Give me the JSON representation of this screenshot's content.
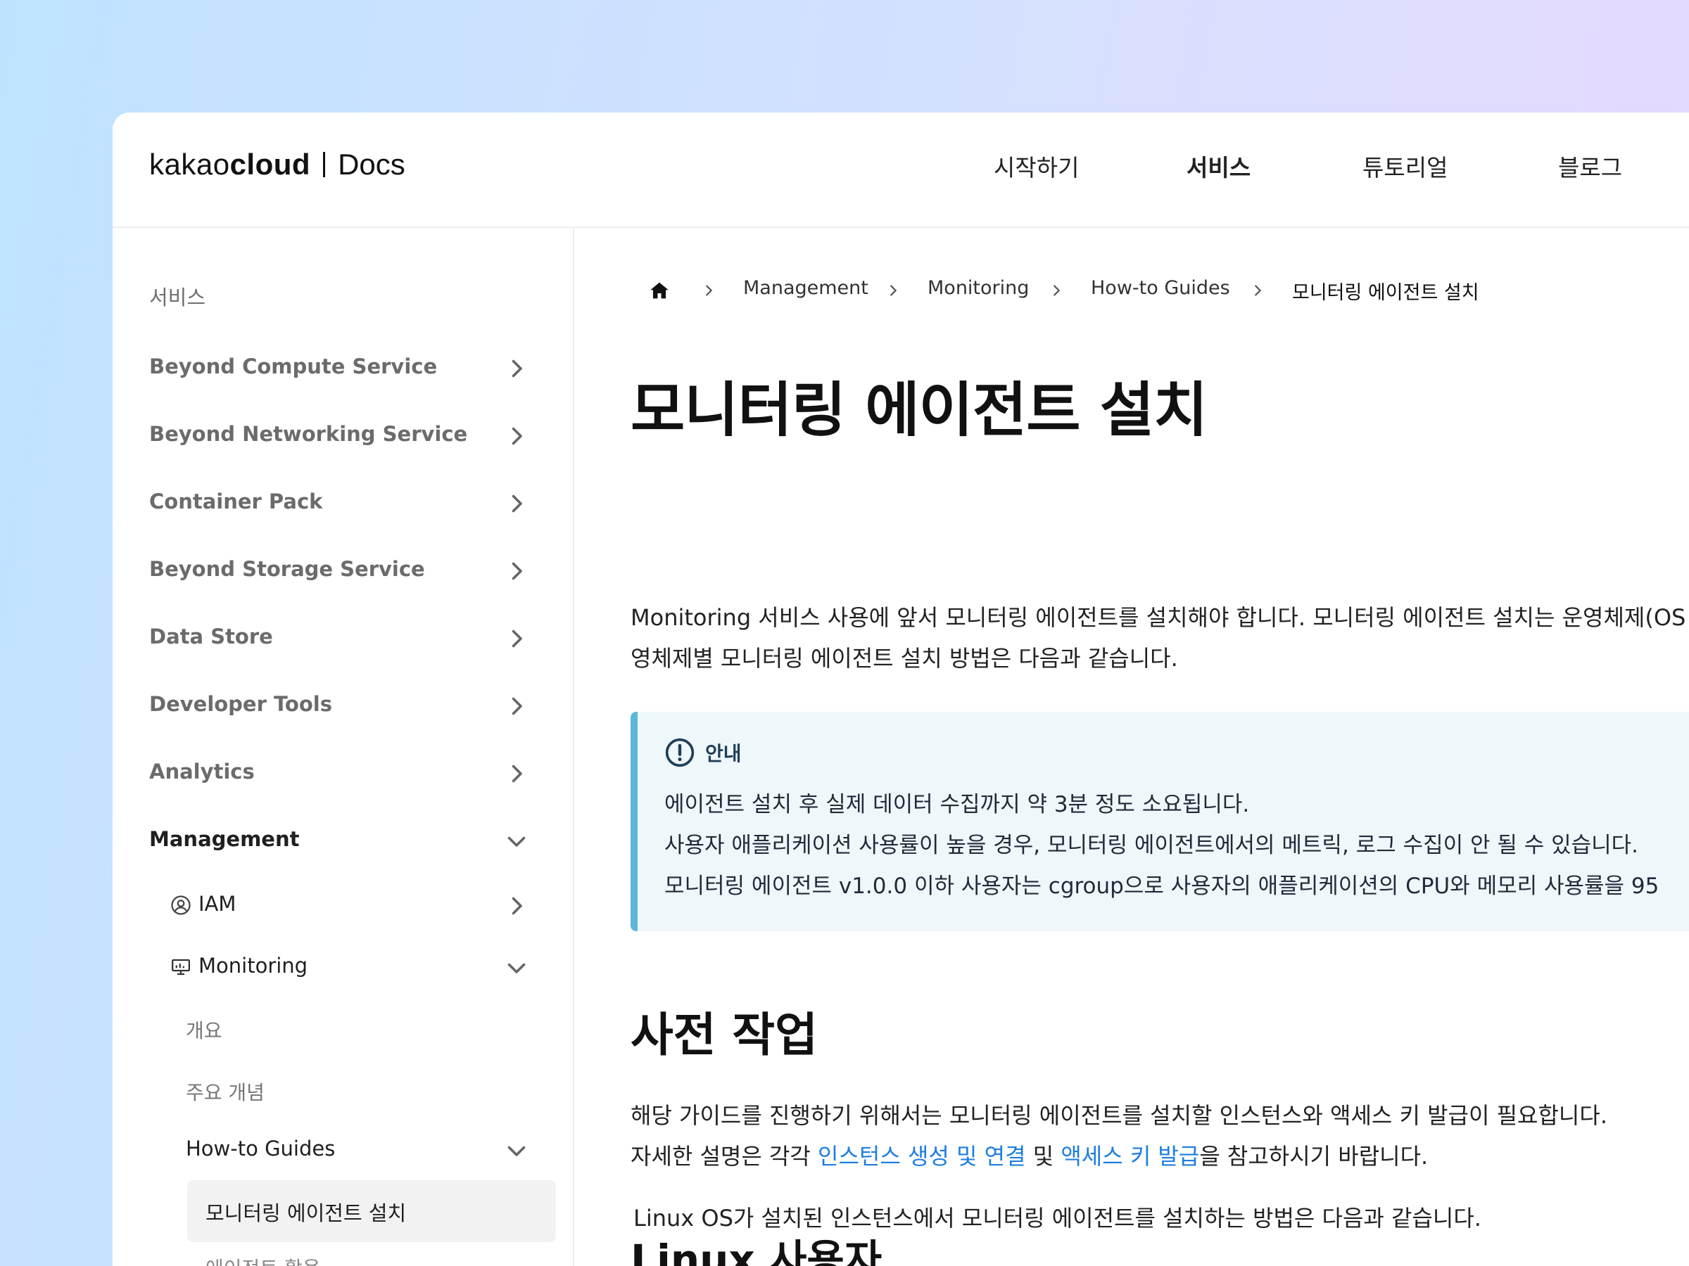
{
  "header": {
    "logo": {
      "kakao": "kakao",
      "cloud": "cloud",
      "docs": "Docs"
    },
    "nav": [
      "시작하기",
      "서비스",
      "튜토리얼",
      "블로그"
    ],
    "active_nav": "서비스"
  },
  "sidebar": {
    "heading": "서비스",
    "items": [
      {
        "label": "Beyond Compute Service"
      },
      {
        "label": "Beyond Networking Service"
      },
      {
        "label": "Container Pack"
      },
      {
        "label": "Beyond Storage Service"
      },
      {
        "label": "Data Store"
      },
      {
        "label": "Developer Tools"
      },
      {
        "label": "Analytics"
      },
      {
        "label": "Management"
      }
    ],
    "management_children": {
      "iam": "IAM",
      "monitoring": "Monitoring"
    },
    "monitoring_children": {
      "overview": "개요",
      "concepts": "주요 개념",
      "guides": "How-to Guides",
      "selected": "모니터링 에이전트 설치",
      "next_cut": "에이전트 활용"
    }
  },
  "breadcrumb": [
    "Management",
    "Monitoring",
    "How-to Guides",
    "모니터링 에이전트 설치"
  ],
  "content": {
    "title": "모니터링 에이전트 설치",
    "intro": [
      "Monitoring 서비스 사용에 앞서 모니터링 에이전트를 설치해야 합니다. 모니터링 에이전트 설치는 운영체제(OS",
      "영체제별 모니터링 에이전트 설치 방법은 다음과 같습니다."
    ],
    "callout": {
      "title": "안내",
      "lines": [
        "에이전트 설치 후 실제 데이터 수집까지 약 3분 정도 소요됩니다.",
        "사용자 애플리케이션 사용률이 높을 경우, 모니터링 에이전트에서의 메트릭, 로그 수집이 안 될 수 있습니다.",
        "모니터링 에이전트 v1.0.0 이하 사용자는 cgroup으로 사용자의 애플리케이션의 CPU와 메모리 사용률을 95"
      ]
    },
    "prereq": {
      "heading": "사전 작업",
      "line1": "해당 가이드를 진행하기 위해서는 모니터링 에이전트를 설치할 인스턴스와 액세스 키 발급이 필요합니다.",
      "line2_prefix": "자세한 설명은 각각 ",
      "link1": "인스턴스 생성 및 연결",
      "line2_mid": " 및 ",
      "link2": "액세스 키 발급",
      "line2_suffix": "을 참고하시기 바랍니다."
    },
    "linux": {
      "heading": "Linux 사용자",
      "line": "Linux OS가 설치된 인스턴스에서 모니터링 에이전트를 설치하는 방법은 다음과 같습니다."
    }
  },
  "colors": {
    "accent_link": "#1e7ee0",
    "callout_bg": "#eef7fa",
    "callout_border": "#5bb7d8",
    "selected_bg": "#f2f2f2"
  },
  "icons": [
    "home-icon",
    "chevron-right-icon",
    "chevron-down-icon",
    "user-circle-icon",
    "monitor-icon",
    "info-circle-icon"
  ]
}
